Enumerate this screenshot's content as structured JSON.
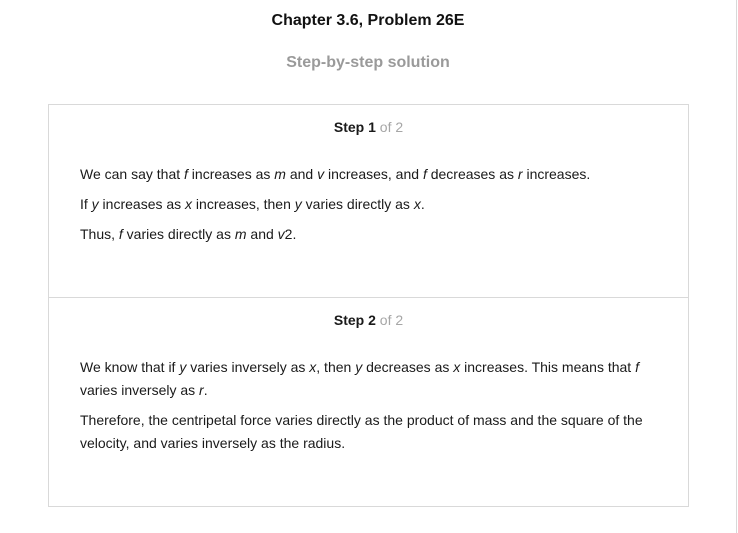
{
  "header": {
    "chapter_title": "Chapter 3.6, Problem 26E",
    "subtitle": "Step-by-step solution"
  },
  "steps": [
    {
      "label": "Step",
      "number": "1",
      "of_text": "of 2",
      "paragraphs": [
        [
          {
            "t": "We can say that ",
            "i": false
          },
          {
            "t": "f",
            "i": true
          },
          {
            "t": " increases as ",
            "i": false
          },
          {
            "t": "m",
            "i": true
          },
          {
            "t": " and ",
            "i": false
          },
          {
            "t": "v",
            "i": true
          },
          {
            "t": " increases, and ",
            "i": false
          },
          {
            "t": "f",
            "i": true
          },
          {
            "t": " decreases as ",
            "i": false
          },
          {
            "t": "r",
            "i": true
          },
          {
            "t": " increases.",
            "i": false
          }
        ],
        [
          {
            "t": "If ",
            "i": false
          },
          {
            "t": "y",
            "i": true
          },
          {
            "t": " increases as ",
            "i": false
          },
          {
            "t": "x",
            "i": true
          },
          {
            "t": " increases, then ",
            "i": false
          },
          {
            "t": "y",
            "i": true
          },
          {
            "t": " varies directly as ",
            "i": false
          },
          {
            "t": "x",
            "i": true
          },
          {
            "t": ".",
            "i": false
          }
        ],
        [
          {
            "t": "Thus, ",
            "i": false
          },
          {
            "t": "f",
            "i": true
          },
          {
            "t": " varies directly as ",
            "i": false
          },
          {
            "t": "m",
            "i": true
          },
          {
            "t": " and ",
            "i": false
          },
          {
            "t": "v",
            "i": true
          },
          {
            "t": "2.",
            "i": false
          }
        ]
      ]
    },
    {
      "label": "Step",
      "number": "2",
      "of_text": "of 2",
      "paragraphs": [
        [
          {
            "t": "We know that if ",
            "i": false
          },
          {
            "t": "y",
            "i": true
          },
          {
            "t": " varies inversely as ",
            "i": false
          },
          {
            "t": "x",
            "i": true
          },
          {
            "t": ", then ",
            "i": false
          },
          {
            "t": "y",
            "i": true
          },
          {
            "t": " decreases as ",
            "i": false
          },
          {
            "t": "x",
            "i": true
          },
          {
            "t": " increases. This means that ",
            "i": false
          },
          {
            "t": "f",
            "i": true
          },
          {
            "t": " varies inversely as ",
            "i": false
          },
          {
            "t": "r",
            "i": true
          },
          {
            "t": ".",
            "i": false
          }
        ],
        [
          {
            "t": "Therefore, the centripetal force varies directly as the product of mass and the square of the velocity, and varies inversely as the radius.",
            "i": false
          }
        ]
      ]
    }
  ]
}
